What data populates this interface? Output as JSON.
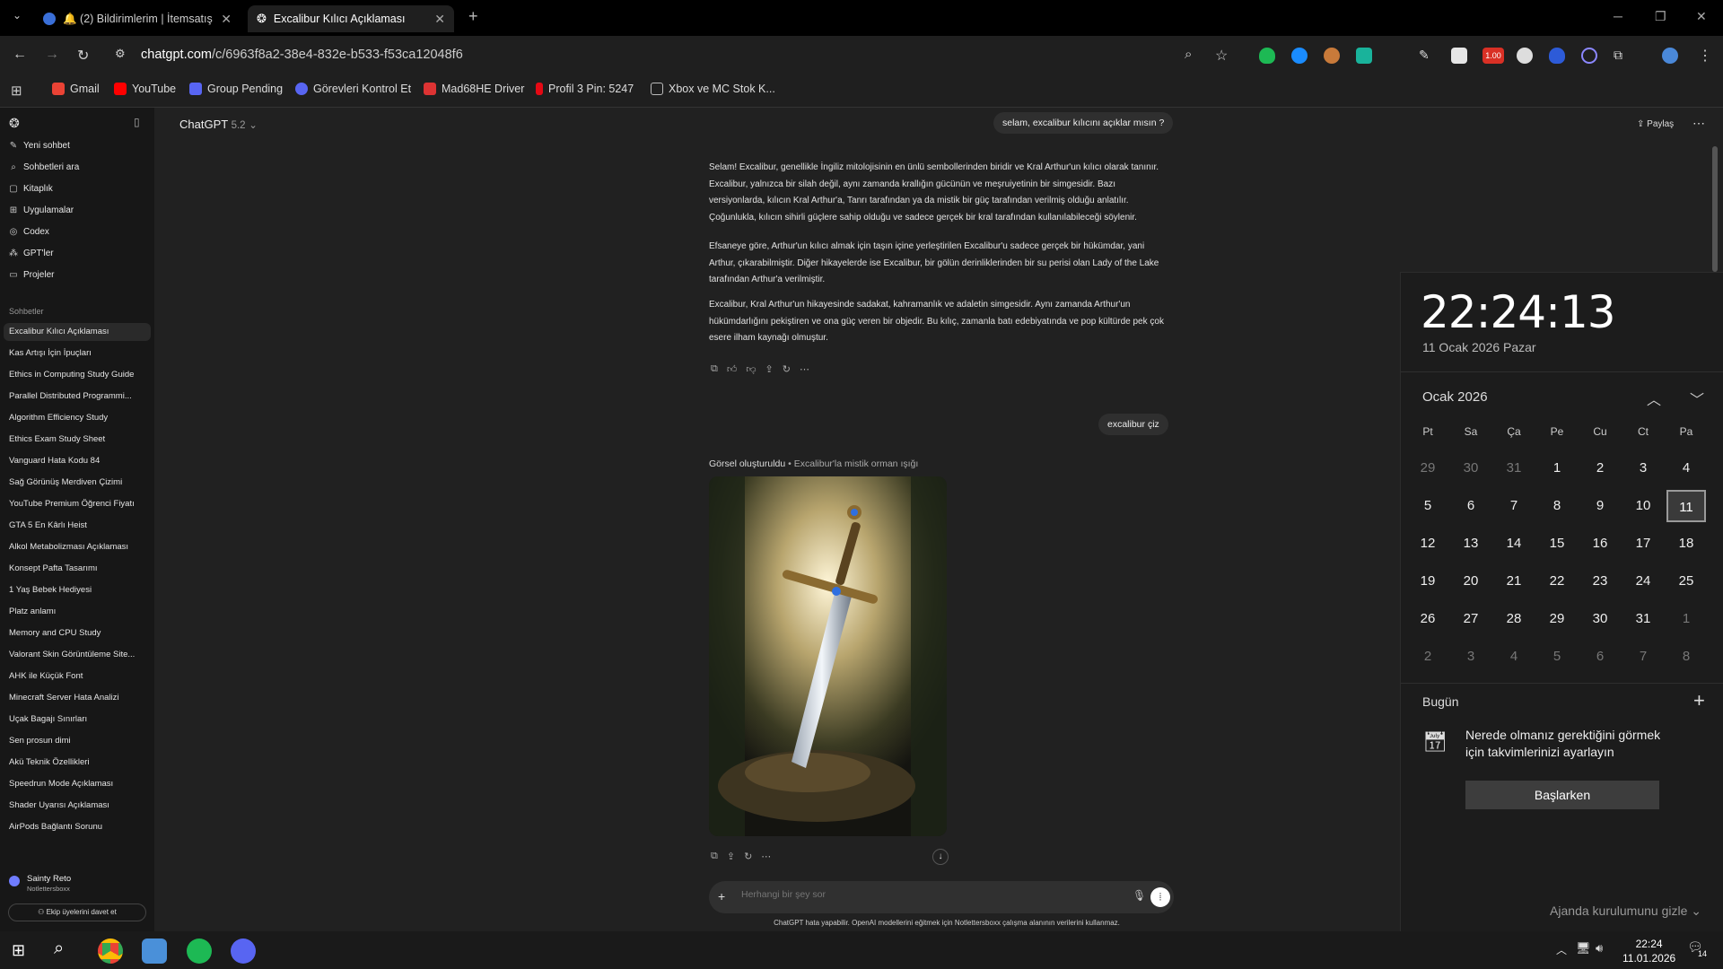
{
  "tabs": [
    {
      "label": "🔔 (2) Bildirimlerim | İtemsatış"
    },
    {
      "label": "Excalibur Kılıcı Açıklaması"
    }
  ],
  "browser": {
    "url_domain": "chatgpt.com",
    "url_path": "/c/6963f8a2-38e4-832e-b533-f53ca12048f6",
    "badge": "1.00"
  },
  "bookmarks": [
    {
      "label": "Gmail",
      "color": "#ea4335"
    },
    {
      "label": "YouTube",
      "color": "#ff0000"
    },
    {
      "label": "Group Pending",
      "color": "#5865f2"
    },
    {
      "label": "Görevleri Kontrol Et",
      "color": "#5865f2"
    },
    {
      "label": "Mad68HE Driver",
      "color": "#d33"
    },
    {
      "label": "Profil 3 Pin: 5247",
      "color": "#e50914"
    },
    {
      "label": "Xbox ve MC Stok K...",
      "color": "#bbb"
    }
  ],
  "sidebar": {
    "nav": [
      {
        "label": "Yeni sohbet",
        "icon": "✎"
      },
      {
        "label": "Sohbetleri ara",
        "icon": "⌕"
      },
      {
        "label": "Kitaplık",
        "icon": "▢"
      },
      {
        "label": "Uygulamalar",
        "icon": "⊞"
      },
      {
        "label": "Codex",
        "icon": "◎"
      },
      {
        "label": "GPT'ler",
        "icon": "⁂"
      },
      {
        "label": "Projeler",
        "icon": "▭"
      }
    ],
    "section_label": "Sohbetler",
    "chats": [
      "Excalibur Kılıcı Açıklaması",
      "Kas Artışı İçin İpuçları",
      "Ethics in Computing Study Guide",
      "Parallel Distributed Programmi...",
      "Algorithm Efficiency Study",
      "Ethics Exam Study Sheet",
      "Vanguard Hata Kodu 84",
      "Sağ Görünüş Merdiven Çizimi",
      "YouTube Premium Öğrenci Fiyatı",
      "GTA 5 En Kârlı Heist",
      "Alkol Metabolizması Açıklaması",
      "Konsept Pafta Tasarımı",
      "1 Yaş Bebek Hediyesi",
      "Platz anlamı",
      "Memory and CPU Study",
      "Valorant Skin Görüntüleme Site...",
      "AHK ile Küçük Font",
      "Minecraft Server Hata Analizi",
      "Uçak Bagajı Sınırları",
      "Sen prosun dimi",
      "Akü Teknik Özellikleri",
      "Speedrun Mode Açıklaması",
      "Shader Uyarısı Açıklaması",
      "AirPods Bağlantı Sorunu"
    ],
    "user_name": "Sainty Reto",
    "user_org": "Notlettersboxx",
    "invite_label": "Ekip üyelerini davet et"
  },
  "main": {
    "model_name": "ChatGPT",
    "model_version": "5.2",
    "share_label": "Paylaş",
    "user_msg_1": "selam, excalibur kılıcını açıklar mısın ?",
    "assistant_paragraphs": [
      "Selam! Excalibur, genellikle İngiliz mitolojisinin en ünlü sembollerinden biridir ve Kral Arthur'un kılıcı olarak tanınır. Excalibur, yalnızca bir silah değil, aynı zamanda krallığın gücünün ve meşruiyetinin bir simgesidir. Bazı versiyonlarda, kılıcın Kral Arthur'a, Tanrı tarafından ya da mistik bir güç tarafından verilmiş olduğu anlatılır. Çoğunlukla, kılıcın sihirli güçlere sahip olduğu ve sadece gerçek bir kral tarafından kullanılabileceği söylenir.",
      "Efsaneye göre, Arthur'un kılıcı almak için taşın içine yerleştirilen Excalibur'u sadece gerçek bir hükümdar, yani Arthur, çıkarabilmiştir. Diğer hikayelerde ise Excalibur, bir gölün derinliklerinden bir su perisi olan Lady of the Lake tarafından Arthur'a verilmiştir.",
      "Excalibur, Kral Arthur'un hikayesinde sadakat, kahramanlık ve adaletin simgesidir. Aynı zamanda Arthur'un hükümdarlığını pekiştiren ve ona güç veren bir objedir. Bu kılıç, zamanla batı edebiyatında ve pop kültürde pek çok esere ilham kaynağı olmuştur."
    ],
    "user_msg_2": "excalibur çiz",
    "image_caption_title": "Görsel oluşturuldu",
    "image_caption_sub": "• Excalibur'la mistik orman ışığı",
    "composer_placeholder": "Herhangi bir şey sor",
    "disclaimer": "ChatGPT hata yapabilir. OpenAI modellerini eğitmek için Notlettersboxx çalışma alanının verilerini kullanmaz."
  },
  "calendar": {
    "time": "22:24:13",
    "full_date": "11 Ocak 2026 Pazar",
    "month_label": "Ocak 2026",
    "weekdays": [
      "Pt",
      "Sa",
      "Ça",
      "Pe",
      "Cu",
      "Ct",
      "Pa"
    ],
    "weeks": [
      [
        "29",
        "30",
        "31",
        "1",
        "2",
        "3",
        "4"
      ],
      [
        "5",
        "6",
        "7",
        "8",
        "9",
        "10",
        "11"
      ],
      [
        "12",
        "13",
        "14",
        "15",
        "16",
        "17",
        "18"
      ],
      [
        "19",
        "20",
        "21",
        "22",
        "23",
        "24",
        "25"
      ],
      [
        "26",
        "27",
        "28",
        "29",
        "30",
        "31",
        "1"
      ],
      [
        "2",
        "3",
        "4",
        "5",
        "6",
        "7",
        "8"
      ]
    ],
    "today": "11",
    "today_label": "Bugün",
    "event_message": "Nerede olmanız gerektiğini görmek için takvimlerinizi ayarlayın",
    "start_button": "Başlarken",
    "hide_agenda": "Ajanda kurulumunu gizle"
  },
  "taskbar": {
    "time": "22:24",
    "date": "11.01.2026",
    "notif_count": "14"
  }
}
